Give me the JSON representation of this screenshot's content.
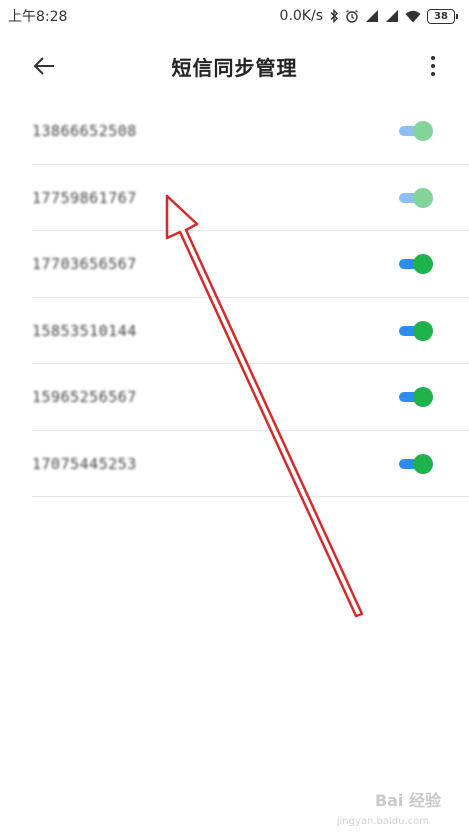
{
  "status_bar": {
    "time": "上午8:28",
    "net_speed": "0.0K/s",
    "battery": "38"
  },
  "title_bar": {
    "title": "短信同步管理"
  },
  "contacts": [
    {
      "number": "13866652508",
      "enabled": true,
      "faded": true
    },
    {
      "number": "17759861767",
      "enabled": true,
      "faded": true
    },
    {
      "number": "17703656567",
      "enabled": true,
      "faded": false
    },
    {
      "number": "15853510144",
      "enabled": true,
      "faded": false
    },
    {
      "number": "15965256567",
      "enabled": true,
      "faded": false
    },
    {
      "number": "17075445253",
      "enabled": true,
      "faded": false
    }
  ],
  "watermark": {
    "brand": "Bai 经验",
    "url": "jingyan.baidu.com"
  },
  "colors": {
    "toggle_track": "#2d8cf0",
    "toggle_knob": "#1fb24a",
    "annotation": "#d42a2a"
  }
}
